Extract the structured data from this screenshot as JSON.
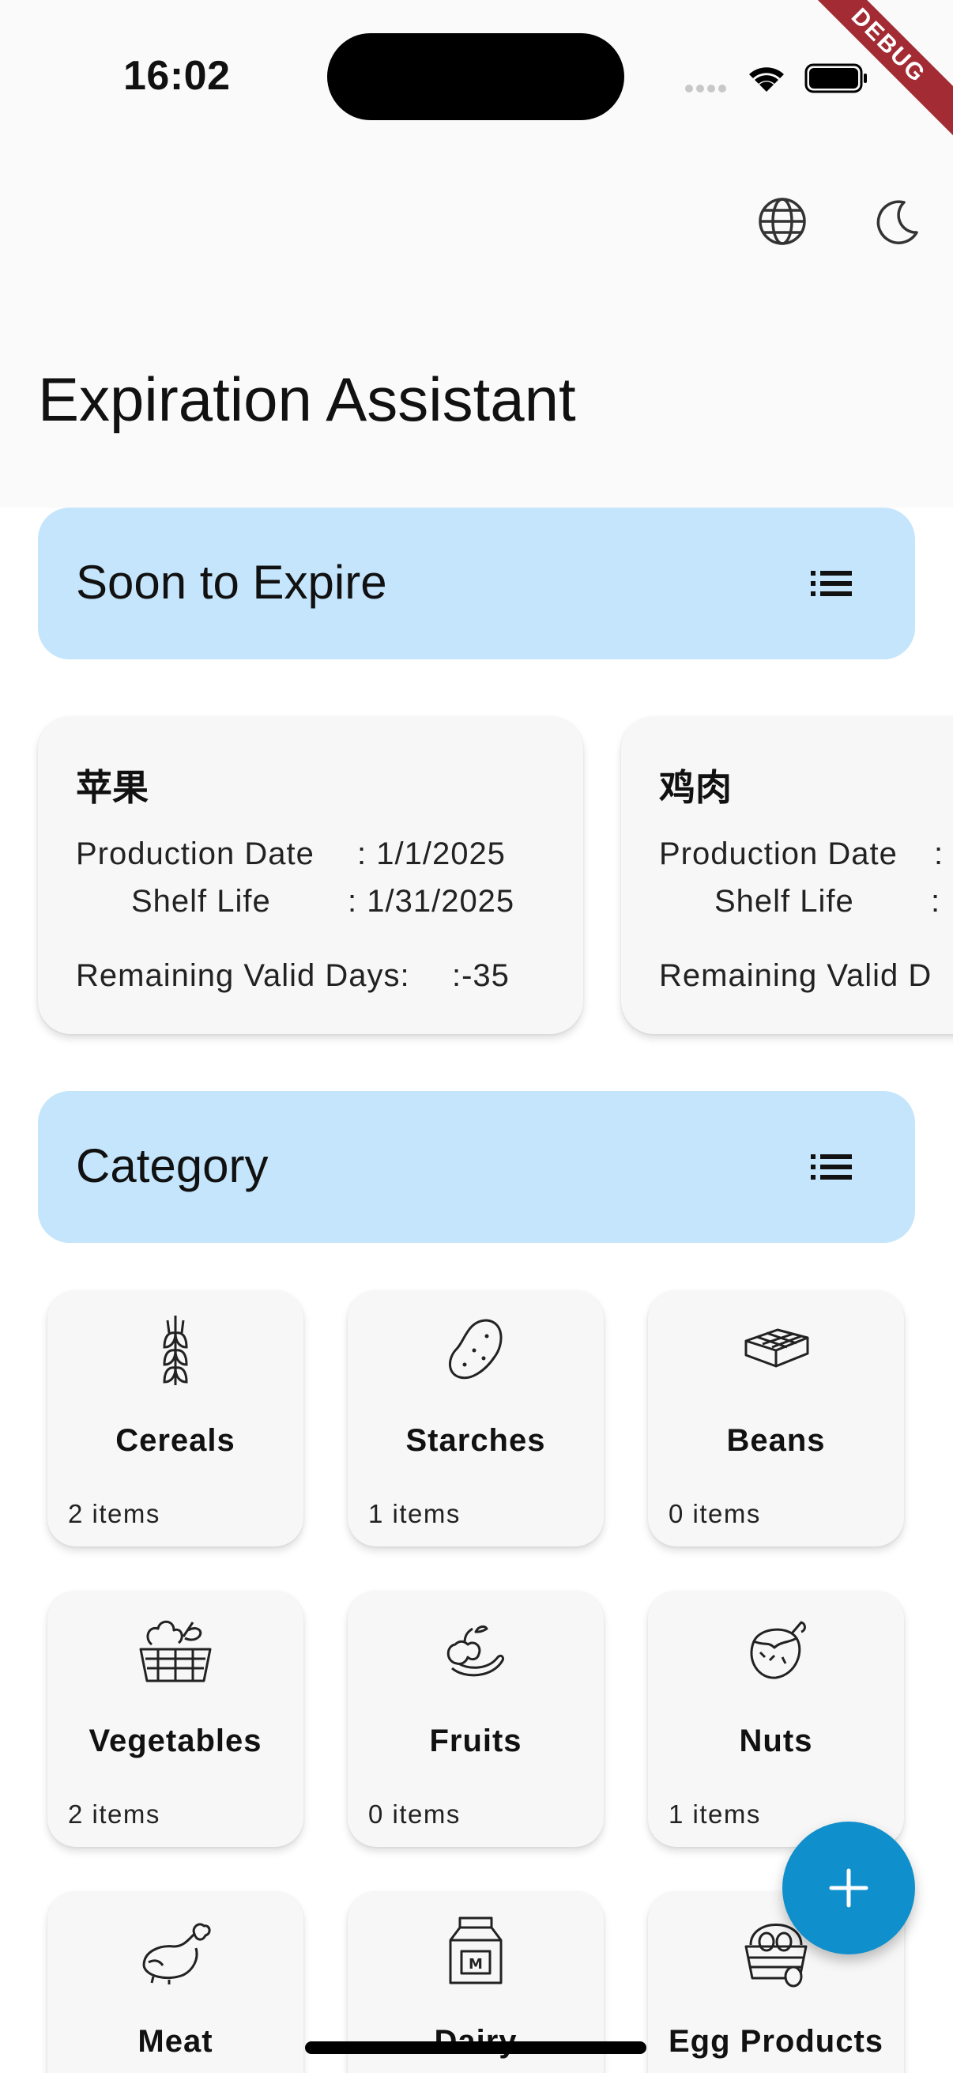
{
  "status_bar": {
    "time": "16:02"
  },
  "debug_banner": "DEBUG",
  "app_bar": {
    "title": "Expiration Assistant",
    "actions": [
      {
        "icon": "globe-icon",
        "label": "language"
      },
      {
        "icon": "moon-icon",
        "label": "dark-mode"
      }
    ]
  },
  "soon_to_expire": {
    "header": "Soon to Expire",
    "cards": [
      {
        "name": "苹果",
        "production_label": "Production Date",
        "production_value": ": 1/1/2025",
        "shelf_label": "Shelf Life",
        "shelf_value": ": 1/31/2025",
        "remaining_label": "Remaining Valid Days:",
        "remaining_value": ":-35"
      },
      {
        "name": "鸡肉",
        "production_label": "Production Date",
        "production_value": ":",
        "shelf_label": "Shelf Life",
        "shelf_value": ":",
        "remaining_label": "Remaining Valid D"
      }
    ]
  },
  "category": {
    "header": "Category",
    "items": [
      {
        "name": "Cereals",
        "count": "2 items",
        "icon": "wheat-icon"
      },
      {
        "name": "Starches",
        "count": "1 items",
        "icon": "potato-icon"
      },
      {
        "name": "Beans",
        "count": "0 items",
        "icon": "tofu-icon"
      },
      {
        "name": "Vegetables",
        "count": "2 items",
        "icon": "vegetable-basket-icon"
      },
      {
        "name": "Fruits",
        "count": "0 items",
        "icon": "fruits-icon"
      },
      {
        "name": "Nuts",
        "count": "1 items",
        "icon": "nut-icon"
      },
      {
        "name": "Meat",
        "icon": "chicken-leg-icon"
      },
      {
        "name": "Dairy",
        "icon": "milk-carton-icon"
      },
      {
        "name": "Egg Products",
        "icon": "egg-basket-icon"
      }
    ]
  },
  "fab": {
    "icon": "plus-icon"
  },
  "colors": {
    "section_header_bg": "#c4e5fb",
    "fab": "#0f8fcc",
    "debug_ribbon": "#a22b34"
  }
}
